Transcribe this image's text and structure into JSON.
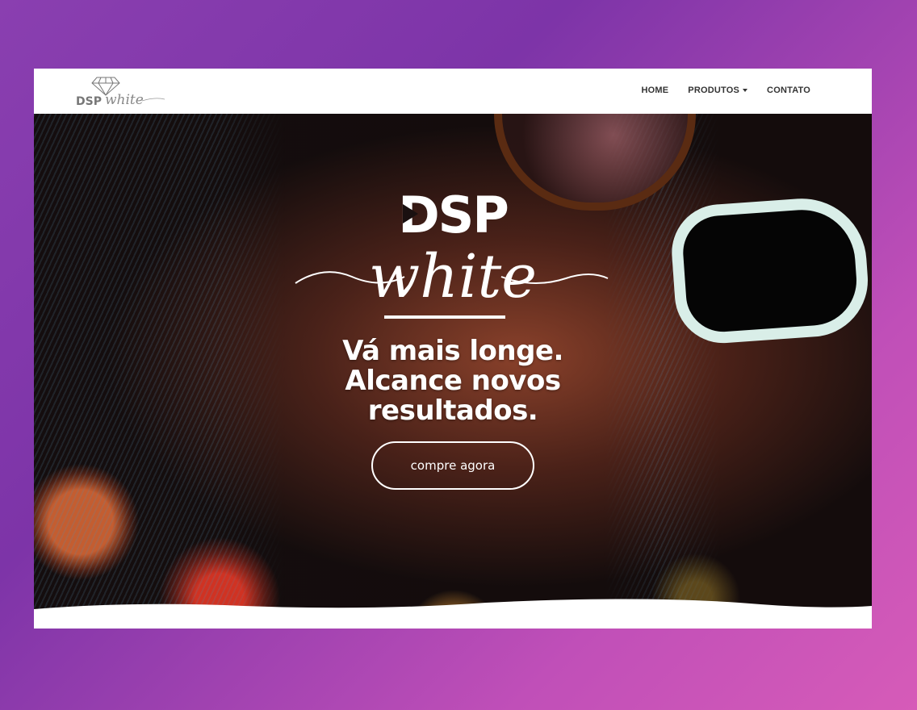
{
  "brand": {
    "name_top": "DSP",
    "name_script": "white",
    "header_logo_alt": "DSP white"
  },
  "nav": {
    "items": [
      {
        "label": "HOME",
        "has_dropdown": false
      },
      {
        "label": "PRODUTOS",
        "has_dropdown": true
      },
      {
        "label": "CONTATO",
        "has_dropdown": false
      }
    ]
  },
  "hero": {
    "headline_line1": "Vá mais longe.",
    "headline_line2": "Alcance novos",
    "headline_line3": "resultados.",
    "cta_label": "compre agora"
  },
  "colors": {
    "background_gradient_start": "#8a3fb0",
    "background_gradient_end": "#d65bb8",
    "nav_text": "#333333",
    "hero_text": "#ffffff"
  }
}
